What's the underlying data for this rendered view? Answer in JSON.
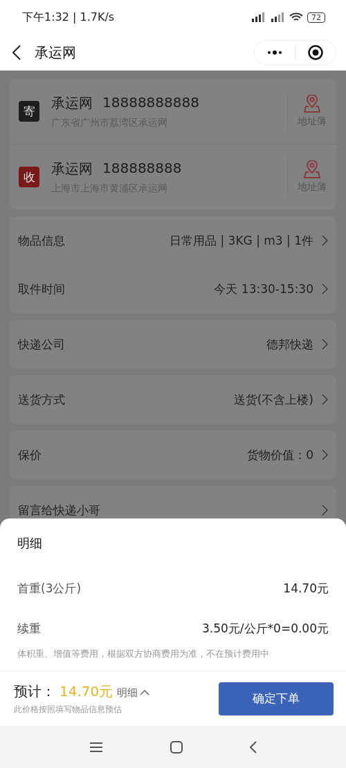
{
  "status_bar": {
    "time": "下午1:32 | 1.7K/s",
    "battery": "72"
  },
  "nav": {
    "title": "承运网"
  },
  "contacts": [
    {
      "badge": "寄",
      "color": "#1e1e1e",
      "name": "承运网",
      "phone": "18888888888",
      "address": "广东省广州市荔湾区承运网",
      "book_label": "地址薄"
    },
    {
      "badge": "收",
      "color": "#7a1a18",
      "name": "承运网",
      "phone": "188888888",
      "address": "上海市上海市黄浦区承运网",
      "book_label": "地址薄"
    }
  ],
  "form_groups": [
    [
      {
        "label": "物品信息",
        "value": "日常用品 | 3KG | m3 | 1件"
      },
      {
        "label": "取件时间",
        "value": "今天 13:30-15:30"
      }
    ],
    [
      {
        "label": "快递公司",
        "value": "德邦快递"
      }
    ],
    [
      {
        "label": "送货方式",
        "value": "送货(不含上楼)"
      }
    ],
    [
      {
        "label": "保价",
        "value": "货物价值：0"
      }
    ],
    [
      {
        "label": "留言给快递小哥"
      }
    ]
  ],
  "sheet": {
    "title": "明细",
    "lines": [
      {
        "label": "首重(3公斤)",
        "value": "14.70元"
      },
      {
        "label": "续重",
        "value": "3.50元/公斤*0=0.00元"
      }
    ],
    "note": "体积重、增值等费用，根据双方协商费用为准，不在预计费用中"
  },
  "footer": {
    "estimate_label": "预计：",
    "amount": "14.70元",
    "detail_toggle": "明细",
    "hint": "此价格按照填写物品信息预估",
    "submit": "确定下单"
  }
}
